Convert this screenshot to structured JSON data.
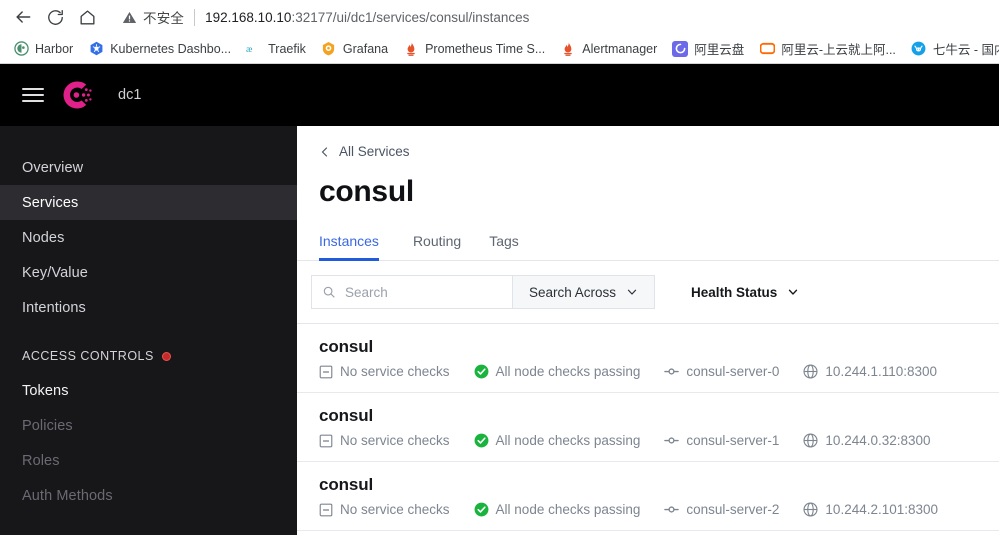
{
  "browser": {
    "nav_buttons": [
      {
        "name": "back-button",
        "icon": "arrow-left-icon"
      },
      {
        "name": "reload-button",
        "icon": "reload-icon"
      },
      {
        "name": "home-button",
        "icon": "home-icon"
      }
    ],
    "security_label": "不安全",
    "url_host": "192.168.10.10",
    "url_rest": ":32177/ui/dc1/services/consul/instances",
    "bookmarks": [
      {
        "label": "Harbor",
        "icon": "harbor-icon",
        "color": "#4a8f6f"
      },
      {
        "label": "Kubernetes Dashbo...",
        "icon": "kubernetes-icon",
        "color": "#3370e8"
      },
      {
        "label": "Traefik",
        "icon": "traefik-icon",
        "color": "#24a0c0"
      },
      {
        "label": "Grafana",
        "icon": "grafana-icon",
        "color": "#f4a321"
      },
      {
        "label": "Prometheus Time S...",
        "icon": "prometheus-icon",
        "color": "#e6522c"
      },
      {
        "label": "Alertmanager",
        "icon": "prometheus-icon",
        "color": "#e6522c"
      },
      {
        "label": "阿里云盘",
        "icon": "aliyun-drive-icon",
        "color": "#6c6ae8"
      },
      {
        "label": "阿里云-上云就上阿...",
        "icon": "aliyun-icon",
        "color": "#ff6a00"
      },
      {
        "label": "七牛云 - 国内领",
        "icon": "qiniu-icon",
        "color": "#15a0e8"
      }
    ]
  },
  "topbar": {
    "menu_icon": "hamburger-menu-icon",
    "logo_icon": "consul-logo-icon",
    "datacenter": "dc1",
    "logo_color": "#e0218a"
  },
  "sidebar": {
    "items": [
      {
        "label": "Overview",
        "state": "normal"
      },
      {
        "label": "Services",
        "state": "active"
      },
      {
        "label": "Nodes",
        "state": "normal"
      },
      {
        "label": "Key/Value",
        "state": "normal"
      },
      {
        "label": "Intentions",
        "state": "normal"
      }
    ],
    "section": {
      "label": "ACCESS CONTROLS",
      "badge_color": "#c62a2a"
    },
    "acl_items": [
      {
        "label": "Tokens",
        "state": "bright"
      },
      {
        "label": "Policies",
        "state": "dim"
      },
      {
        "label": "Roles",
        "state": "dim"
      },
      {
        "label": "Auth Methods",
        "state": "dim"
      }
    ]
  },
  "main": {
    "breadcrumb": "All Services",
    "title": "consul",
    "tabs": [
      {
        "label": "Instances",
        "active": true
      },
      {
        "label": "Routing",
        "active": false
      },
      {
        "label": "Tags",
        "active": false
      }
    ],
    "filters": {
      "search_placeholder": "Search",
      "search_value": "",
      "search_across_label": "Search Across",
      "health_status_label": "Health Status"
    },
    "accent_color": "#1f5bdb",
    "instances": [
      {
        "name": "consul",
        "service_checks": "No service checks",
        "node_checks": "All node checks passing",
        "node": "consul-server-0",
        "address": "10.244.1.110:8300"
      },
      {
        "name": "consul",
        "service_checks": "No service checks",
        "node_checks": "All node checks passing",
        "node": "consul-server-1",
        "address": "10.244.0.32:8300"
      },
      {
        "name": "consul",
        "service_checks": "No service checks",
        "node_checks": "All node checks passing",
        "node": "consul-server-2",
        "address": "10.244.2.101:8300"
      }
    ]
  }
}
